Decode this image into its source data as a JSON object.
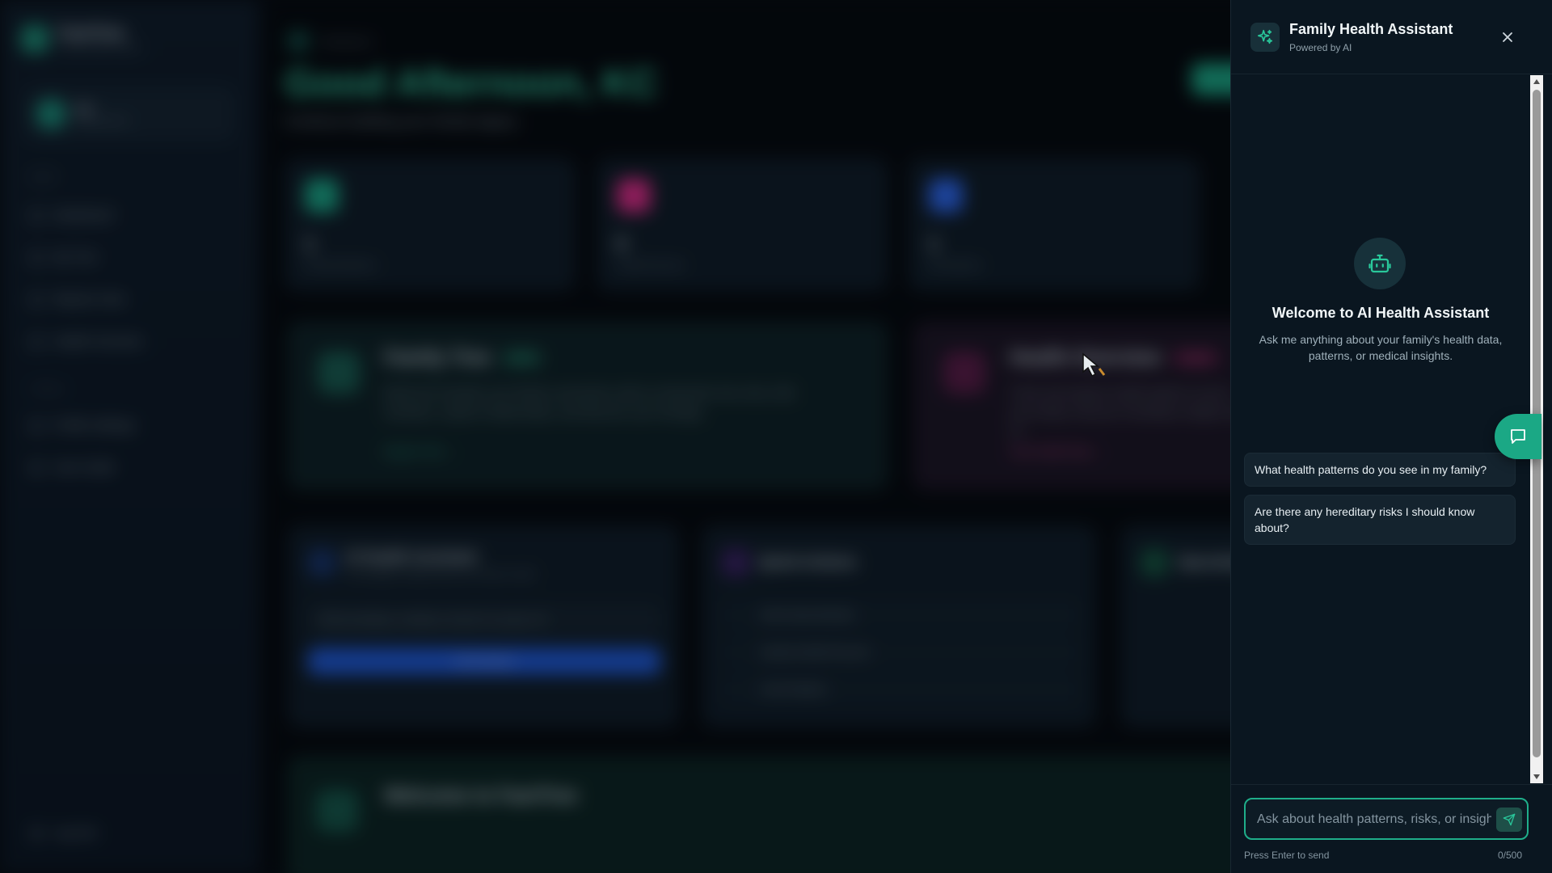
{
  "background_app": {
    "brand_name": "FamTree",
    "brand_sub": "Family health tracker",
    "user_name": "KC",
    "user_sub": "Family Admin",
    "section_main": "MAIN",
    "section_settings": "TOOLS",
    "nav_items": [
      "Dashboard",
      "My Tree",
      "Reports View",
      "Health Overview"
    ],
    "nav_items_2": [
      "Profile Settings",
      "User Guide"
    ],
    "logout": "Log Out",
    "breadcrumb": "Dashboard",
    "greeting": "Good Afternoon, KC",
    "greeting_sub": "Continue building your family legacy",
    "stats": [
      {
        "value": "1",
        "label": "Family Members",
        "color": "#1aa887"
      },
      {
        "value": "0",
        "label": "Health Records",
        "color": "#e22b8a"
      },
      {
        "value": "1",
        "label": "Generations",
        "color": "#2c67f0"
      }
    ],
    "feature_cards": [
      {
        "title": "Family Tree",
        "pill": "Active",
        "text": "Build and visualize your family connections with an interactive tree view. Add members, explore relationships, and discover your heritage.",
        "link": "Explore Tree →",
        "color": "#1aa887"
      },
      {
        "title": "Health Overview",
        "pill": "Insights",
        "text": "Track and analyze health patterns across your family. Discover hereditary insights with AI.",
        "link": "View Health Data →",
        "color": "#e22b8a"
      }
    ],
    "ai_card": {
      "title": "AI Health Assistant",
      "sub": "Get intelligent insights about your family's health",
      "input": "What hereditary conditions should I be aware of?",
      "button": "Ask Assistant"
    },
    "actions_card": {
      "title": "Quick Actions",
      "rows": [
        "Add Family Member",
        "Upload Health Records",
        "Invite Relative"
      ]
    },
    "third_card_title": "Upcoming",
    "welcome_title": "Welcome to FamTree"
  },
  "assistant": {
    "title": "Family Health Assistant",
    "subtitle": "Powered by AI",
    "welcome_title": "Welcome to AI Health Assistant",
    "welcome_text": "Ask me anything about your family's health data, patterns, or medical insights.",
    "suggestions": [
      "What health patterns do you see in my family?",
      "Are there any hereditary risks I should know about?"
    ],
    "input_placeholder": "Ask about health patterns, risks, or insights...",
    "hint": "Press Enter to send",
    "counter": "0/500",
    "accent": "#1fae8a"
  },
  "icons": {
    "header": "sparkle-icon",
    "close": "close-icon",
    "welcome": "bot-icon",
    "send": "send-icon",
    "fab": "chat-bubble-icon"
  }
}
